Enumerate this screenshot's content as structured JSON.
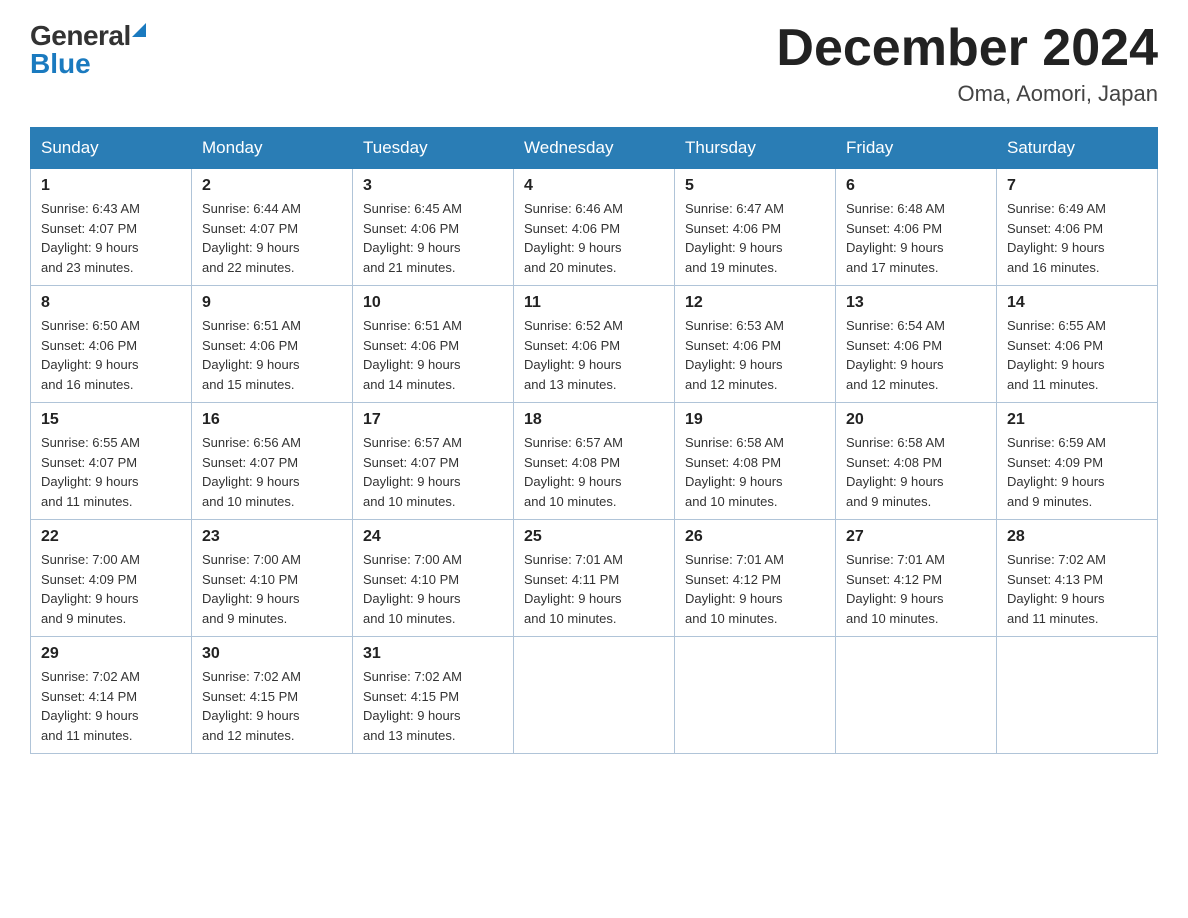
{
  "logo": {
    "general": "General",
    "blue": "Blue"
  },
  "header": {
    "month": "December 2024",
    "location": "Oma, Aomori, Japan"
  },
  "weekdays": [
    "Sunday",
    "Monday",
    "Tuesday",
    "Wednesday",
    "Thursday",
    "Friday",
    "Saturday"
  ],
  "weeks": [
    [
      {
        "day": "1",
        "sunrise": "6:43 AM",
        "sunset": "4:07 PM",
        "daylight": "9 hours and 23 minutes."
      },
      {
        "day": "2",
        "sunrise": "6:44 AM",
        "sunset": "4:07 PM",
        "daylight": "9 hours and 22 minutes."
      },
      {
        "day": "3",
        "sunrise": "6:45 AM",
        "sunset": "4:06 PM",
        "daylight": "9 hours and 21 minutes."
      },
      {
        "day": "4",
        "sunrise": "6:46 AM",
        "sunset": "4:06 PM",
        "daylight": "9 hours and 20 minutes."
      },
      {
        "day": "5",
        "sunrise": "6:47 AM",
        "sunset": "4:06 PM",
        "daylight": "9 hours and 19 minutes."
      },
      {
        "day": "6",
        "sunrise": "6:48 AM",
        "sunset": "4:06 PM",
        "daylight": "9 hours and 17 minutes."
      },
      {
        "day": "7",
        "sunrise": "6:49 AM",
        "sunset": "4:06 PM",
        "daylight": "9 hours and 16 minutes."
      }
    ],
    [
      {
        "day": "8",
        "sunrise": "6:50 AM",
        "sunset": "4:06 PM",
        "daylight": "9 hours and 16 minutes."
      },
      {
        "day": "9",
        "sunrise": "6:51 AM",
        "sunset": "4:06 PM",
        "daylight": "9 hours and 15 minutes."
      },
      {
        "day": "10",
        "sunrise": "6:51 AM",
        "sunset": "4:06 PM",
        "daylight": "9 hours and 14 minutes."
      },
      {
        "day": "11",
        "sunrise": "6:52 AM",
        "sunset": "4:06 PM",
        "daylight": "9 hours and 13 minutes."
      },
      {
        "day": "12",
        "sunrise": "6:53 AM",
        "sunset": "4:06 PM",
        "daylight": "9 hours and 12 minutes."
      },
      {
        "day": "13",
        "sunrise": "6:54 AM",
        "sunset": "4:06 PM",
        "daylight": "9 hours and 12 minutes."
      },
      {
        "day": "14",
        "sunrise": "6:55 AM",
        "sunset": "4:06 PM",
        "daylight": "9 hours and 11 minutes."
      }
    ],
    [
      {
        "day": "15",
        "sunrise": "6:55 AM",
        "sunset": "4:07 PM",
        "daylight": "9 hours and 11 minutes."
      },
      {
        "day": "16",
        "sunrise": "6:56 AM",
        "sunset": "4:07 PM",
        "daylight": "9 hours and 10 minutes."
      },
      {
        "day": "17",
        "sunrise": "6:57 AM",
        "sunset": "4:07 PM",
        "daylight": "9 hours and 10 minutes."
      },
      {
        "day": "18",
        "sunrise": "6:57 AM",
        "sunset": "4:08 PM",
        "daylight": "9 hours and 10 minutes."
      },
      {
        "day": "19",
        "sunrise": "6:58 AM",
        "sunset": "4:08 PM",
        "daylight": "9 hours and 10 minutes."
      },
      {
        "day": "20",
        "sunrise": "6:58 AM",
        "sunset": "4:08 PM",
        "daylight": "9 hours and 9 minutes."
      },
      {
        "day": "21",
        "sunrise": "6:59 AM",
        "sunset": "4:09 PM",
        "daylight": "9 hours and 9 minutes."
      }
    ],
    [
      {
        "day": "22",
        "sunrise": "7:00 AM",
        "sunset": "4:09 PM",
        "daylight": "9 hours and 9 minutes."
      },
      {
        "day": "23",
        "sunrise": "7:00 AM",
        "sunset": "4:10 PM",
        "daylight": "9 hours and 9 minutes."
      },
      {
        "day": "24",
        "sunrise": "7:00 AM",
        "sunset": "4:10 PM",
        "daylight": "9 hours and 10 minutes."
      },
      {
        "day": "25",
        "sunrise": "7:01 AM",
        "sunset": "4:11 PM",
        "daylight": "9 hours and 10 minutes."
      },
      {
        "day": "26",
        "sunrise": "7:01 AM",
        "sunset": "4:12 PM",
        "daylight": "9 hours and 10 minutes."
      },
      {
        "day": "27",
        "sunrise": "7:01 AM",
        "sunset": "4:12 PM",
        "daylight": "9 hours and 10 minutes."
      },
      {
        "day": "28",
        "sunrise": "7:02 AM",
        "sunset": "4:13 PM",
        "daylight": "9 hours and 11 minutes."
      }
    ],
    [
      {
        "day": "29",
        "sunrise": "7:02 AM",
        "sunset": "4:14 PM",
        "daylight": "9 hours and 11 minutes."
      },
      {
        "day": "30",
        "sunrise": "7:02 AM",
        "sunset": "4:15 PM",
        "daylight": "9 hours and 12 minutes."
      },
      {
        "day": "31",
        "sunrise": "7:02 AM",
        "sunset": "4:15 PM",
        "daylight": "9 hours and 13 minutes."
      },
      null,
      null,
      null,
      null
    ]
  ],
  "labels": {
    "sunrise": "Sunrise:",
    "sunset": "Sunset:",
    "daylight": "Daylight:"
  }
}
